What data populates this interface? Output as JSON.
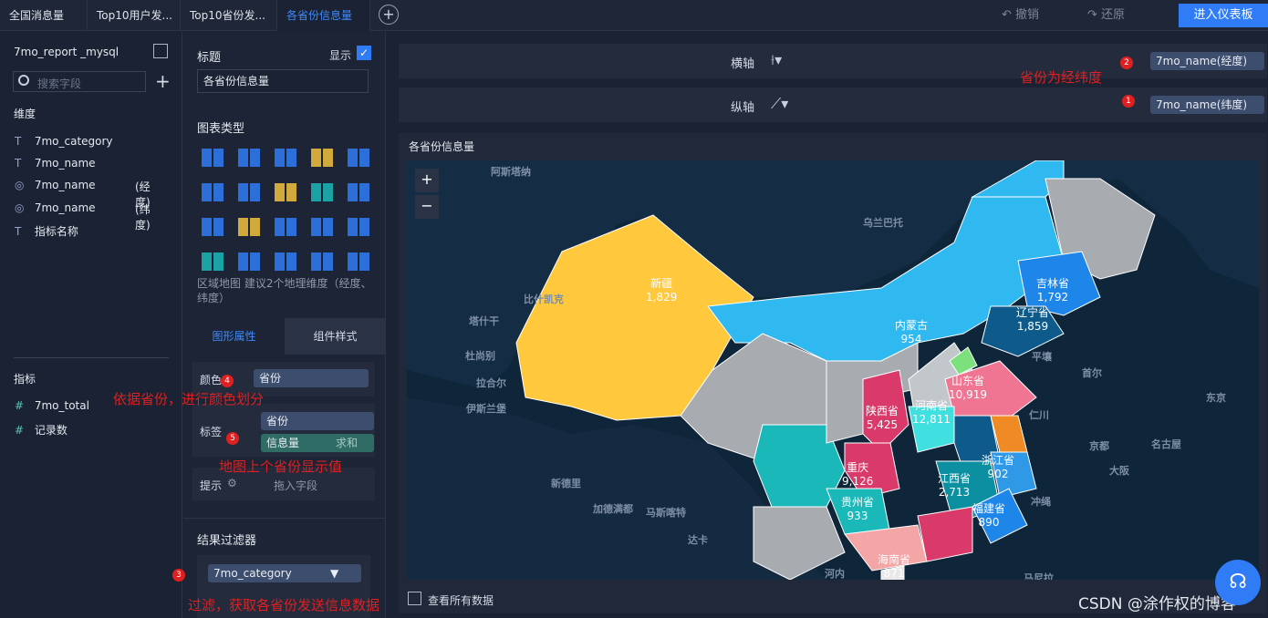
{
  "tabs": [
    "全国消息量",
    "Top10用户发...",
    "Top10省份发...",
    "各省份信息量"
  ],
  "toolbar": {
    "undo": "撤销",
    "redo": "还原",
    "enter": "进入仪表板"
  },
  "datasource": {
    "name": "7mo_report _mysql",
    "search_placeholder": "搜索字段"
  },
  "dimensions": {
    "title": "维度",
    "items": [
      {
        "icon": "T",
        "name": "7mo_category",
        "suffix": ""
      },
      {
        "icon": "T",
        "name": "7mo_name",
        "suffix": ""
      },
      {
        "icon": "globe",
        "name": "7mo_name",
        "suffix": "(经度)"
      },
      {
        "icon": "globe",
        "name": "7mo_name",
        "suffix": "(纬度)"
      },
      {
        "icon": "T",
        "name": "指标名称",
        "suffix": ""
      }
    ]
  },
  "measures": {
    "title": "指标",
    "items": [
      {
        "icon": "#",
        "name": "7mo_total"
      },
      {
        "icon": "#",
        "name": "记录数"
      }
    ]
  },
  "config": {
    "title_label": "标题",
    "show_label": "显示",
    "title_value": "各省份信息量",
    "chart_type_label": "图表类型",
    "chart_hint": "区域地图 建议2个地理维度（经度、纬度）",
    "tab_graphic": "图形属性",
    "tab_style": "组件样式",
    "color_label": "颜色",
    "color_field": "省份",
    "label_label": "标签",
    "label_field1": "省份",
    "label_field2": "信息量",
    "label_field2_agg": "求和",
    "tooltip_label": "提示",
    "tooltip_placeholder": "拖入字段",
    "filter_title": "结果过滤器",
    "filter_field": "7mo_category"
  },
  "axes": {
    "x_label": "横轴",
    "x_field": "7mo_name(经度)",
    "y_label": "纵轴",
    "y_field": "7mo_name(纬度)"
  },
  "chart": {
    "title": "各省份信息量",
    "zoom_in": "+",
    "zoom_out": "−",
    "view_all": "查看所有数据"
  },
  "map_regions": [
    {
      "name": "新疆",
      "value": "1,829"
    },
    {
      "name": "吉林省",
      "value": "1,792"
    },
    {
      "name": "辽宁省",
      "value": "1,859"
    },
    {
      "name": "内蒙古",
      "value": "954"
    },
    {
      "name": "山东省",
      "value": "10,919"
    },
    {
      "name": "陕西省",
      "value": "5,425"
    },
    {
      "name": "河南省",
      "value": "12,811"
    },
    {
      "name": "浙江省",
      "value": "902"
    },
    {
      "name": "重庆",
      "value": "9,126"
    },
    {
      "name": "江西省",
      "value": "2,713"
    },
    {
      "name": "贵州省",
      "value": "933"
    },
    {
      "name": "福建省",
      "value": "890"
    },
    {
      "name": "海南省",
      "value": "871"
    }
  ],
  "geo_names": [
    "阿斯塔纳",
    "乌兰巴托",
    "比什凯克",
    "塔什干",
    "杜尚别",
    "伊斯兰堡",
    "新德里",
    "加德满都",
    "平壤",
    "首尔",
    "东京",
    "仁川",
    "名古屋",
    "京都",
    "大阪",
    "冲绳",
    "达卡",
    "河内",
    "马尼拉",
    "马斯喀特",
    "拉合尔"
  ],
  "annotations": {
    "a1": "省份为经纬度",
    "a2": "依据省份，进行颜色划分",
    "a3": "地图上个省份显示值",
    "a4": "过滤，获取各省份发送信息数据",
    "watermark": "CSDN @涂作权的博客"
  },
  "badges": [
    "1",
    "2",
    "3",
    "4",
    "5"
  ]
}
